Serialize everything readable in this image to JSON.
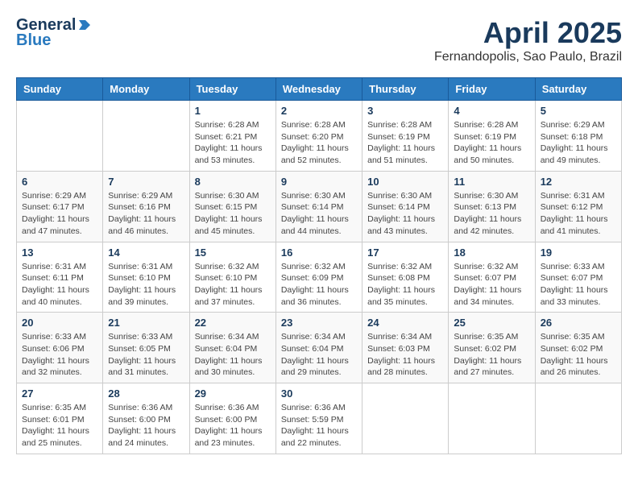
{
  "logo": {
    "general": "General",
    "blue": "Blue"
  },
  "header": {
    "title": "April 2025",
    "subtitle": "Fernandopolis, Sao Paulo, Brazil"
  },
  "weekdays": [
    "Sunday",
    "Monday",
    "Tuesday",
    "Wednesday",
    "Thursday",
    "Friday",
    "Saturday"
  ],
  "weeks": [
    [
      {
        "day": "",
        "info": ""
      },
      {
        "day": "",
        "info": ""
      },
      {
        "day": "1",
        "info": "Sunrise: 6:28 AM\nSunset: 6:21 PM\nDaylight: 11 hours and 53 minutes."
      },
      {
        "day": "2",
        "info": "Sunrise: 6:28 AM\nSunset: 6:20 PM\nDaylight: 11 hours and 52 minutes."
      },
      {
        "day": "3",
        "info": "Sunrise: 6:28 AM\nSunset: 6:19 PM\nDaylight: 11 hours and 51 minutes."
      },
      {
        "day": "4",
        "info": "Sunrise: 6:28 AM\nSunset: 6:19 PM\nDaylight: 11 hours and 50 minutes."
      },
      {
        "day": "5",
        "info": "Sunrise: 6:29 AM\nSunset: 6:18 PM\nDaylight: 11 hours and 49 minutes."
      }
    ],
    [
      {
        "day": "6",
        "info": "Sunrise: 6:29 AM\nSunset: 6:17 PM\nDaylight: 11 hours and 47 minutes."
      },
      {
        "day": "7",
        "info": "Sunrise: 6:29 AM\nSunset: 6:16 PM\nDaylight: 11 hours and 46 minutes."
      },
      {
        "day": "8",
        "info": "Sunrise: 6:30 AM\nSunset: 6:15 PM\nDaylight: 11 hours and 45 minutes."
      },
      {
        "day": "9",
        "info": "Sunrise: 6:30 AM\nSunset: 6:14 PM\nDaylight: 11 hours and 44 minutes."
      },
      {
        "day": "10",
        "info": "Sunrise: 6:30 AM\nSunset: 6:14 PM\nDaylight: 11 hours and 43 minutes."
      },
      {
        "day": "11",
        "info": "Sunrise: 6:30 AM\nSunset: 6:13 PM\nDaylight: 11 hours and 42 minutes."
      },
      {
        "day": "12",
        "info": "Sunrise: 6:31 AM\nSunset: 6:12 PM\nDaylight: 11 hours and 41 minutes."
      }
    ],
    [
      {
        "day": "13",
        "info": "Sunrise: 6:31 AM\nSunset: 6:11 PM\nDaylight: 11 hours and 40 minutes."
      },
      {
        "day": "14",
        "info": "Sunrise: 6:31 AM\nSunset: 6:10 PM\nDaylight: 11 hours and 39 minutes."
      },
      {
        "day": "15",
        "info": "Sunrise: 6:32 AM\nSunset: 6:10 PM\nDaylight: 11 hours and 37 minutes."
      },
      {
        "day": "16",
        "info": "Sunrise: 6:32 AM\nSunset: 6:09 PM\nDaylight: 11 hours and 36 minutes."
      },
      {
        "day": "17",
        "info": "Sunrise: 6:32 AM\nSunset: 6:08 PM\nDaylight: 11 hours and 35 minutes."
      },
      {
        "day": "18",
        "info": "Sunrise: 6:32 AM\nSunset: 6:07 PM\nDaylight: 11 hours and 34 minutes."
      },
      {
        "day": "19",
        "info": "Sunrise: 6:33 AM\nSunset: 6:07 PM\nDaylight: 11 hours and 33 minutes."
      }
    ],
    [
      {
        "day": "20",
        "info": "Sunrise: 6:33 AM\nSunset: 6:06 PM\nDaylight: 11 hours and 32 minutes."
      },
      {
        "day": "21",
        "info": "Sunrise: 6:33 AM\nSunset: 6:05 PM\nDaylight: 11 hours and 31 minutes."
      },
      {
        "day": "22",
        "info": "Sunrise: 6:34 AM\nSunset: 6:04 PM\nDaylight: 11 hours and 30 minutes."
      },
      {
        "day": "23",
        "info": "Sunrise: 6:34 AM\nSunset: 6:04 PM\nDaylight: 11 hours and 29 minutes."
      },
      {
        "day": "24",
        "info": "Sunrise: 6:34 AM\nSunset: 6:03 PM\nDaylight: 11 hours and 28 minutes."
      },
      {
        "day": "25",
        "info": "Sunrise: 6:35 AM\nSunset: 6:02 PM\nDaylight: 11 hours and 27 minutes."
      },
      {
        "day": "26",
        "info": "Sunrise: 6:35 AM\nSunset: 6:02 PM\nDaylight: 11 hours and 26 minutes."
      }
    ],
    [
      {
        "day": "27",
        "info": "Sunrise: 6:35 AM\nSunset: 6:01 PM\nDaylight: 11 hours and 25 minutes."
      },
      {
        "day": "28",
        "info": "Sunrise: 6:36 AM\nSunset: 6:00 PM\nDaylight: 11 hours and 24 minutes."
      },
      {
        "day": "29",
        "info": "Sunrise: 6:36 AM\nSunset: 6:00 PM\nDaylight: 11 hours and 23 minutes."
      },
      {
        "day": "30",
        "info": "Sunrise: 6:36 AM\nSunset: 5:59 PM\nDaylight: 11 hours and 22 minutes."
      },
      {
        "day": "",
        "info": ""
      },
      {
        "day": "",
        "info": ""
      },
      {
        "day": "",
        "info": ""
      }
    ]
  ]
}
